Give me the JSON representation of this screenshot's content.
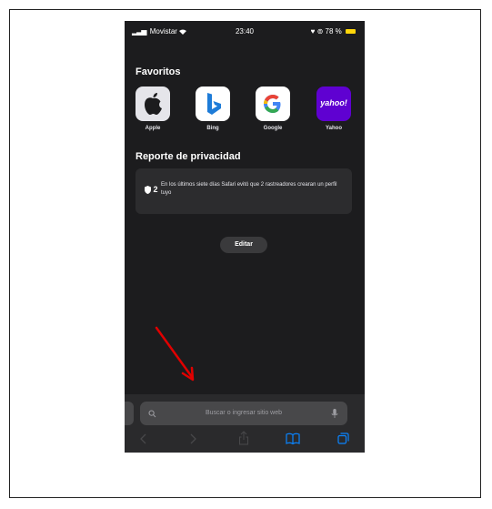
{
  "status_bar": {
    "carrier": "Movistar",
    "time": "23:40",
    "battery": "78 %"
  },
  "favorites": {
    "title": "Favoritos",
    "items": [
      {
        "label": "Apple",
        "icon": "apple-icon"
      },
      {
        "label": "Bing",
        "icon": "bing-icon"
      },
      {
        "label": "Google",
        "icon": "google-icon"
      },
      {
        "label": "Yahoo",
        "icon": "yahoo-icon",
        "logo_text": "yahoo!"
      }
    ]
  },
  "privacy": {
    "title": "Reporte de privacidad",
    "count": "2",
    "description": "En los últimos siete días Safari evitó que 2 rastreadores crearan un perfil tuyo"
  },
  "edit_label": "Editar",
  "address_bar": {
    "placeholder": "Buscar o ingresar sitio web"
  },
  "colors": {
    "background": "#1c1c1e",
    "accent": "#0a84ff",
    "annotation_arrow": "#e00000",
    "yahoo": "#5f01d1"
  }
}
